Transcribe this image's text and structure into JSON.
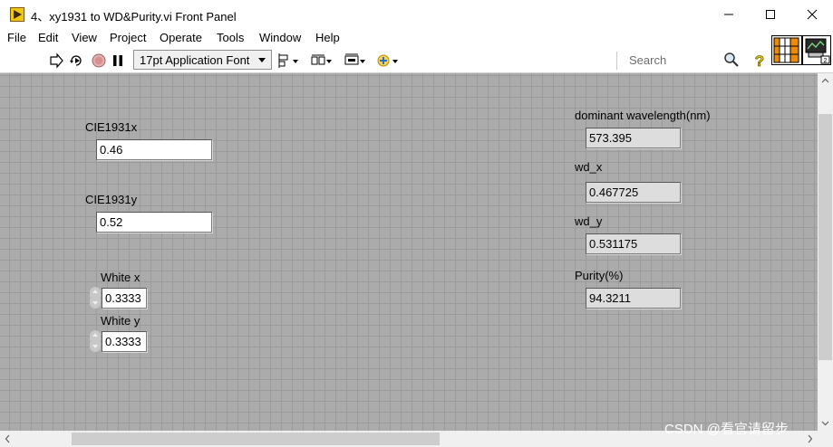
{
  "window": {
    "title": "4、xy1931 to WD&Purity.vi Front Panel"
  },
  "menu": {
    "items": [
      "File",
      "Edit",
      "View",
      "Project",
      "Operate",
      "Tools",
      "Window",
      "Help"
    ]
  },
  "toolbar": {
    "font_selector": "17pt Application Font",
    "search_placeholder": "Search"
  },
  "controls": {
    "cie_x": {
      "label": "CIE1931x",
      "value": "0.46"
    },
    "cie_y": {
      "label": "CIE1931y",
      "value": "0.52"
    },
    "white_x": {
      "label": "White x",
      "value": "0.3333"
    },
    "white_y": {
      "label": "White y",
      "value": "0.3333"
    }
  },
  "indicators": {
    "dominant_wavelength": {
      "label": "dominant wavelength(nm)",
      "value": "573.395"
    },
    "wd_x": {
      "label": "wd_x",
      "value": "0.467725"
    },
    "wd_y": {
      "label": "wd_y",
      "value": "0.531175"
    },
    "purity": {
      "label": "Purity(%)",
      "value": "94.3211"
    }
  },
  "watermark": "CSDN @看官请留步",
  "colors": {
    "panel_bg": "#ababab",
    "grid_line": "#9b9b9b",
    "indicator_bg": "#dddddd",
    "control_bg": "#ffffff",
    "app_icon": "#f2c511"
  },
  "icons": [
    "app-icon",
    "minimize-icon",
    "maximize-icon",
    "close-icon",
    "run-arrow-icon",
    "run-continuously-icon",
    "abort-icon",
    "pause-icon",
    "align-objects-icon",
    "distribute-objects-icon",
    "resize-objects-icon",
    "reorder-icon",
    "search-icon",
    "help-icon"
  ]
}
